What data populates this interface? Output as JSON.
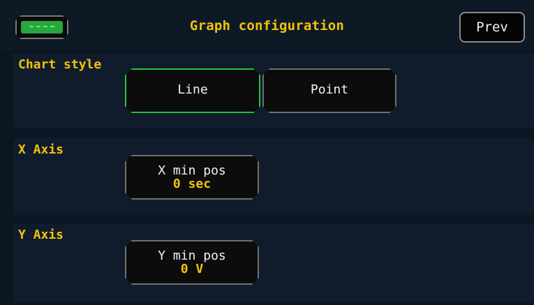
{
  "header": {
    "title": "Graph configuration",
    "prev_label": "Prev",
    "battery_icon": "battery-icon"
  },
  "chart_style": {
    "label": "Chart style",
    "options": [
      {
        "label": "Line",
        "selected": true
      },
      {
        "label": "Point",
        "selected": false
      }
    ]
  },
  "x_axis": {
    "label": "X Axis",
    "min_pos_label": "X min pos",
    "min_pos_value": "0 sec"
  },
  "y_axis": {
    "label": "Y Axis",
    "min_pos_label": "Y min pos",
    "min_pos_value": "0 V"
  },
  "colors": {
    "accent_yellow": "#f2c20c",
    "selected_green": "#21c43a",
    "background": "#0b1622",
    "panel": "#101c2c"
  }
}
